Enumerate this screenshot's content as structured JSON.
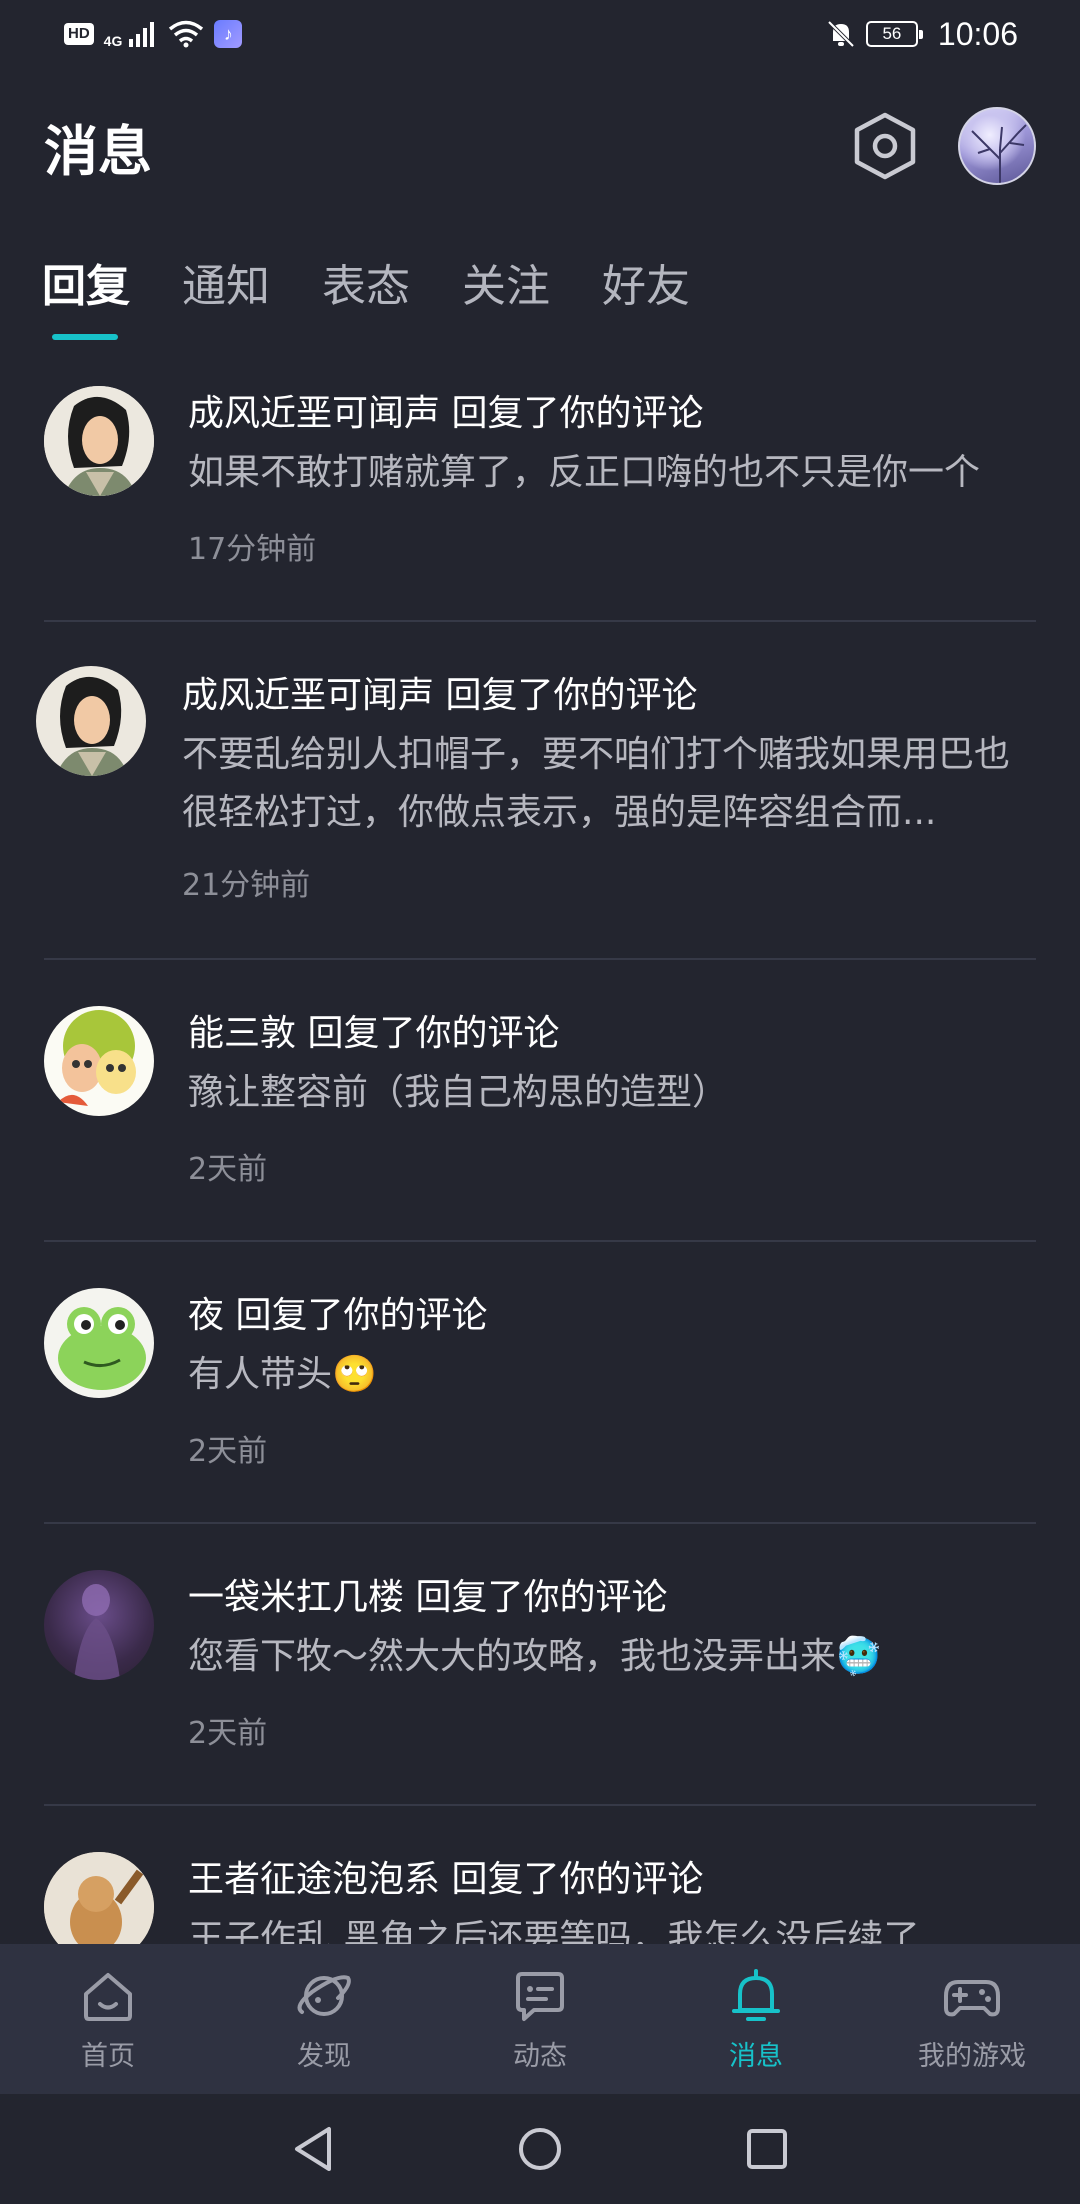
{
  "status_bar": {
    "hd": "HD",
    "network": "4G",
    "battery": "56",
    "time": "10:06",
    "icons": [
      "signal-icon",
      "wifi-icon",
      "app-notification-icon",
      "bell-off-icon",
      "battery-icon"
    ]
  },
  "header": {
    "title": "消息",
    "settings_icon": "settings-hexagon-icon"
  },
  "tabs": [
    {
      "label": "回复",
      "active": true
    },
    {
      "label": "通知"
    },
    {
      "label": "表态"
    },
    {
      "label": "关注"
    },
    {
      "label": "好友"
    }
  ],
  "messages": [
    {
      "user_action": "成风近垩可闻声 回复了你的评论",
      "content": "如果不敢打赌就算了，反正口嗨的也不只是你一个",
      "time": "17分钟前"
    },
    {
      "user_action": "成风近垩可闻声 回复了你的评论",
      "content": "不要乱给别人扣帽子，要不咱们打个赌我如果用巴也很轻松打过，你做点表示，强的是阵容组合而...",
      "time": "21分钟前"
    },
    {
      "user_action": "能三敦 回复了你的评论",
      "content": "豫让整容前（我自己构思的造型）",
      "time": "2天前"
    },
    {
      "user_action": "夜 回复了你的评论",
      "content": "有人带头🙄",
      "time": "2天前"
    },
    {
      "user_action": "一袋米扛几楼 回复了你的评论",
      "content": "您看下牧～然大大的攻略，我也没弄出来🥶",
      "time": "2天前"
    },
    {
      "user_action": "王者征途泡泡系 回复了你的评论",
      "content": "王子作乱 黑角之后还要等吗，我怎么没后续了",
      "time": ""
    }
  ],
  "bottom_nav": [
    {
      "label": "首页",
      "icon": "home-icon"
    },
    {
      "label": "发现",
      "icon": "planet-icon"
    },
    {
      "label": "动态",
      "icon": "chat-icon"
    },
    {
      "label": "消息",
      "icon": "bell-icon",
      "active": true
    },
    {
      "label": "我的游戏",
      "icon": "gamepad-icon"
    }
  ],
  "colors": {
    "background": "#23252f",
    "accent": "#17c2c9",
    "nav_background": "#2f3241"
  }
}
